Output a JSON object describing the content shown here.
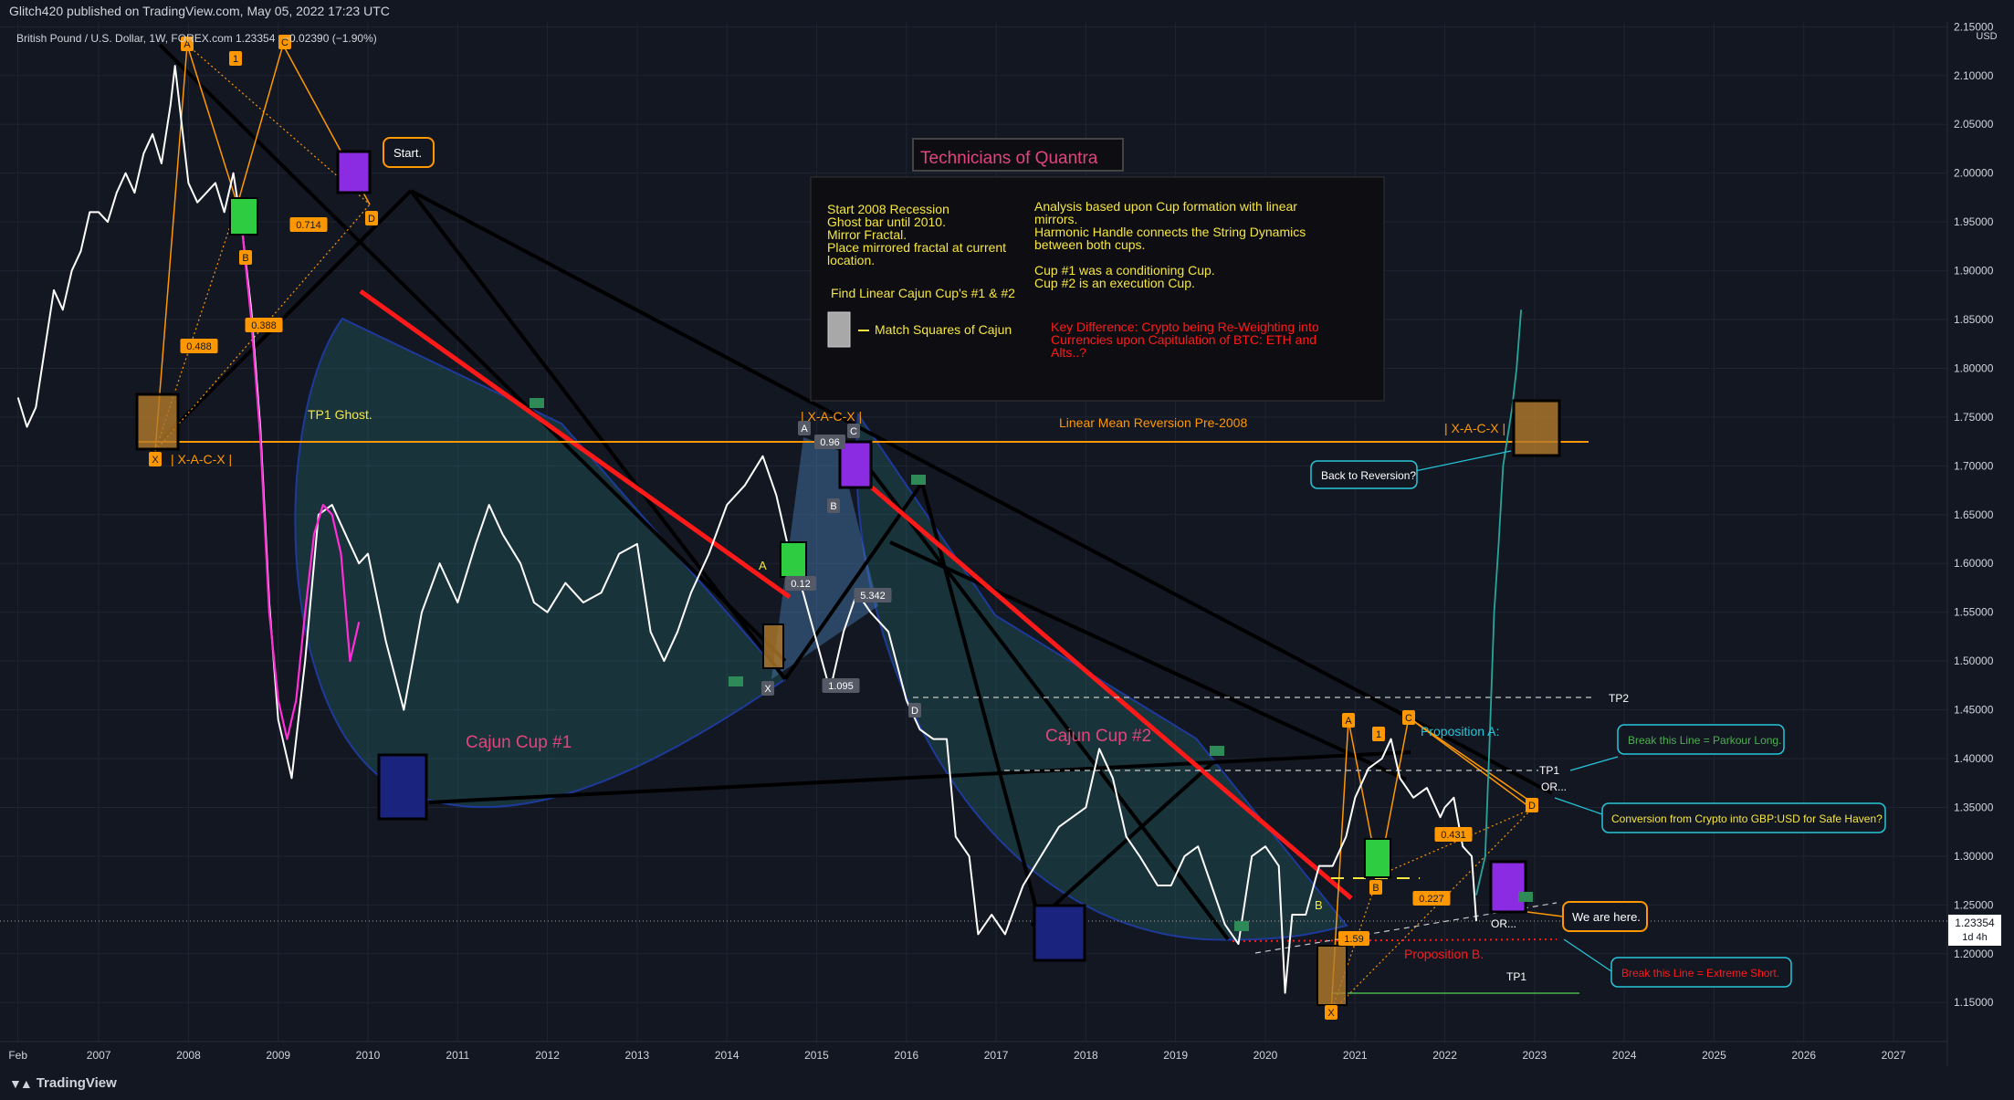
{
  "publisher_line": "Glitch420 published on TradingView.com, May 05, 2022 17:23 UTC",
  "legend": {
    "symbol": "British Pound / U.S. Dollar, 1W, FOREX.com",
    "last": "1.23354",
    "change": "−0.02390 (−1.90%)"
  },
  "brand": "TradingView",
  "colors": {
    "background": "#131722",
    "price_line": "#ffffff",
    "ghost_price": "#ff2ed8",
    "trend_red": "#ff1a1a",
    "trend_black": "#000000",
    "orange": "#ff9800",
    "cup_fill": "#2a7f7f",
    "projection": "#26a69a",
    "title_pink": "#e0457b"
  },
  "chart_data": {
    "type": "line",
    "title": "Technicians of Quantra",
    "y_axis": {
      "unit_label": "USD",
      "ylim": [
        1.11,
        2.155
      ],
      "ticks": [
        "2.15000",
        "2.10000",
        "2.05000",
        "2.00000",
        "1.95000",
        "1.90000",
        "1.85000",
        "1.80000",
        "1.75000",
        "1.70000",
        "1.65000",
        "1.60000",
        "1.55000",
        "1.50000",
        "1.45000",
        "1.40000",
        "1.35000",
        "1.30000",
        "1.25000",
        "1.20000",
        "1.15000"
      ]
    },
    "x_axis": {
      "range": [
        2005.9,
        2027.6
      ],
      "tick_labels": [
        "Feb",
        "2007",
        "2008",
        "2009",
        "2010",
        "2011",
        "2012",
        "2013",
        "2014",
        "2015",
        "2016",
        "2017",
        "2018",
        "2019",
        "2020",
        "2021",
        "2022",
        "2023",
        "2024",
        "2025",
        "2026",
        "2027"
      ],
      "tick_values": [
        2006.1,
        2007,
        2008,
        2009,
        2010,
        2011,
        2012,
        2013,
        2014,
        2015,
        2016,
        2017,
        2018,
        2019,
        2020,
        2021,
        2022,
        2023,
        2024,
        2025,
        2026,
        2027
      ]
    },
    "current_price": {
      "value": "1.23354",
      "countdown": "1d 4h"
    },
    "series": [
      {
        "points": [
          [
            2006.1,
            1.77
          ],
          [
            2006.2,
            1.74
          ],
          [
            2006.3,
            1.76
          ],
          [
            2006.4,
            1.82
          ],
          [
            2006.5,
            1.88
          ],
          [
            2006.6,
            1.86
          ],
          [
            2006.7,
            1.9
          ],
          [
            2006.8,
            1.92
          ],
          [
            2006.9,
            1.96
          ],
          [
            2007.0,
            1.96
          ],
          [
            2007.1,
            1.95
          ],
          [
            2007.2,
            1.98
          ],
          [
            2007.3,
            2.0
          ],
          [
            2007.4,
            1.98
          ],
          [
            2007.5,
            2.02
          ],
          [
            2007.6,
            2.04
          ],
          [
            2007.7,
            2.01
          ],
          [
            2007.8,
            2.07
          ],
          [
            2007.85,
            2.11
          ],
          [
            2007.9,
            2.07
          ],
          [
            2008.0,
            1.99
          ],
          [
            2008.1,
            1.97
          ],
          [
            2008.2,
            1.98
          ],
          [
            2008.3,
            1.99
          ],
          [
            2008.4,
            1.96
          ],
          [
            2008.5,
            2.0
          ],
          [
            2008.6,
            1.94
          ],
          [
            2008.7,
            1.86
          ],
          [
            2008.8,
            1.74
          ],
          [
            2008.9,
            1.56
          ],
          [
            2009.0,
            1.44
          ],
          [
            2009.15,
            1.38
          ],
          [
            2009.3,
            1.5
          ],
          [
            2009.45,
            1.65
          ],
          [
            2009.6,
            1.66
          ],
          [
            2009.75,
            1.63
          ],
          [
            2009.9,
            1.6
          ],
          [
            2010.0,
            1.61
          ],
          [
            2010.2,
            1.52
          ],
          [
            2010.4,
            1.45
          ],
          [
            2010.6,
            1.55
          ],
          [
            2010.8,
            1.6
          ],
          [
            2011.0,
            1.56
          ],
          [
            2011.2,
            1.62
          ],
          [
            2011.35,
            1.66
          ],
          [
            2011.5,
            1.63
          ],
          [
            2011.7,
            1.6
          ],
          [
            2011.85,
            1.56
          ],
          [
            2012.0,
            1.55
          ],
          [
            2012.2,
            1.58
          ],
          [
            2012.4,
            1.56
          ],
          [
            2012.6,
            1.57
          ],
          [
            2012.8,
            1.61
          ],
          [
            2013.0,
            1.62
          ],
          [
            2013.15,
            1.53
          ],
          [
            2013.3,
            1.5
          ],
          [
            2013.45,
            1.53
          ],
          [
            2013.6,
            1.57
          ],
          [
            2013.8,
            1.61
          ],
          [
            2014.0,
            1.66
          ],
          [
            2014.2,
            1.68
          ],
          [
            2014.4,
            1.71
          ],
          [
            2014.55,
            1.67
          ],
          [
            2014.7,
            1.61
          ],
          [
            2014.85,
            1.57
          ],
          [
            2015.0,
            1.52
          ],
          [
            2015.15,
            1.47
          ],
          [
            2015.3,
            1.53
          ],
          [
            2015.45,
            1.57
          ],
          [
            2015.6,
            1.55
          ],
          [
            2015.8,
            1.53
          ],
          [
            2016.0,
            1.46
          ],
          [
            2016.15,
            1.43
          ],
          [
            2016.3,
            1.42
          ],
          [
            2016.45,
            1.42
          ],
          [
            2016.55,
            1.32
          ],
          [
            2016.7,
            1.3
          ],
          [
            2016.8,
            1.22
          ],
          [
            2016.95,
            1.24
          ],
          [
            2017.1,
            1.22
          ],
          [
            2017.3,
            1.27
          ],
          [
            2017.5,
            1.3
          ],
          [
            2017.7,
            1.33
          ],
          [
            2017.85,
            1.34
          ],
          [
            2018.0,
            1.35
          ],
          [
            2018.15,
            1.41
          ],
          [
            2018.3,
            1.38
          ],
          [
            2018.45,
            1.32
          ],
          [
            2018.6,
            1.3
          ],
          [
            2018.8,
            1.27
          ],
          [
            2018.95,
            1.27
          ],
          [
            2019.1,
            1.3
          ],
          [
            2019.25,
            1.31
          ],
          [
            2019.4,
            1.27
          ],
          [
            2019.55,
            1.23
          ],
          [
            2019.7,
            1.21
          ],
          [
            2019.85,
            1.3
          ],
          [
            2020.0,
            1.31
          ],
          [
            2020.15,
            1.29
          ],
          [
            2020.22,
            1.16
          ],
          [
            2020.3,
            1.24
          ],
          [
            2020.45,
            1.24
          ],
          [
            2020.6,
            1.29
          ],
          [
            2020.75,
            1.29
          ],
          [
            2020.9,
            1.32
          ],
          [
            2021.0,
            1.36
          ],
          [
            2021.15,
            1.39
          ],
          [
            2021.3,
            1.4
          ],
          [
            2021.4,
            1.42
          ],
          [
            2021.5,
            1.38
          ],
          [
            2021.65,
            1.36
          ],
          [
            2021.8,
            1.37
          ],
          [
            2021.95,
            1.34
          ],
          [
            2022.0,
            1.35
          ],
          [
            2022.1,
            1.36
          ],
          [
            2022.2,
            1.31
          ],
          [
            2022.3,
            1.3
          ],
          [
            2022.35,
            1.23354
          ]
        ]
      },
      {
        "points": [
          [
            2008.6,
            1.94
          ],
          [
            2008.7,
            1.85
          ],
          [
            2008.8,
            1.73
          ],
          [
            2008.9,
            1.55
          ],
          [
            2009.0,
            1.46
          ],
          [
            2009.1,
            1.42
          ],
          [
            2009.2,
            1.46
          ],
          [
            2009.3,
            1.55
          ],
          [
            2009.4,
            1.63
          ],
          [
            2009.5,
            1.66
          ],
          [
            2009.6,
            1.65
          ],
          [
            2009.7,
            1.61
          ],
          [
            2009.8,
            1.5
          ],
          [
            2009.9,
            1.54
          ]
        ]
      },
      {
        "points": [
          [
            2022.35,
            1.26
          ],
          [
            2022.45,
            1.3
          ],
          [
            2022.5,
            1.42
          ],
          [
            2022.55,
            1.55
          ],
          [
            2022.6,
            1.62
          ],
          [
            2022.65,
            1.7
          ],
          [
            2022.7,
            1.73
          ],
          [
            2022.75,
            1.76
          ],
          [
            2022.8,
            1.8
          ],
          [
            2022.85,
            1.86
          ]
        ]
      }
    ],
    "horizontal_levels": [
      {
        "label": "Linear Mean Reversion Pre-2008",
        "value": 1.725
      },
      {
        "label": "TP2",
        "value": 1.465
      },
      {
        "label": "TP1",
        "value": 1.39
      },
      {
        "label": "TP1",
        "value": 1.16
      }
    ]
  },
  "annotations": {
    "start_callout": "Start.",
    "we_are_here": "We are here.",
    "back_to_reversion": "Back to Reversion?",
    "break_long": "Break this Line = Parkour Long.",
    "conversion": "Conversion from Crypto into GBP:USD for Safe Haven?",
    "break_short": "Break this Line = Extreme Short.",
    "cup1": "Cajun Cup #1",
    "cup2": "Cajun Cup #2",
    "tp1_ghost": "TP1 Ghost.",
    "xacx_left": "| X-A-C-X |",
    "xacx_mid": "| X-A-C-X |",
    "xacx_right": "| X-A-C-X |",
    "proposition_a": "Proposition A:",
    "proposition_b": "Proposition B.",
    "or1": "OR...",
    "or2": "OR...",
    "tp2": "TP2",
    "tp1_upper": "TP1",
    "tp1_lower": "TP1",
    "mean_reversion": "Linear Mean Reversion Pre-2008",
    "fib_0488": "0.488",
    "fib_0388": "0.388",
    "fib_0714": "0.714",
    "fib_0431": "0.431",
    "fib_0227": "0.227",
    "fib_1095": "1.095",
    "fib_5342": "5.342",
    "fib_096": "0.96",
    "fib_bottom": "1.59",
    "fib_mid2": "0.12",
    "pt_X": "X",
    "pt_A": "A",
    "pt_B": "B",
    "pt_C": "C",
    "pt_D": "D",
    "pt_1": "1"
  },
  "info_box": {
    "title": "Technicians of Quantra",
    "left_lines": [
      "Start 2008 Recession",
      "Ghost bar until 2010.",
      "Mirror Fractal.",
      "Place mirrored fractal at current",
      "location."
    ],
    "find_line": "Find Linear Cajun Cup's #1 & #2",
    "match_line": "Match Squares of Cajun",
    "right_lines": [
      "Analysis based upon Cup formation with linear",
      "mirrors.",
      "Harmonic Handle connects the String Dynamics",
      "between both cups.",
      "",
      "Cup #1 was a conditioning Cup.",
      "Cup #2 is an execution Cup."
    ],
    "key_lines": [
      "Key Difference: Crypto being  Re-Weighting into",
      "Currencies upon Capitulation of BTC: ETH and",
      "Alts..?"
    ]
  }
}
